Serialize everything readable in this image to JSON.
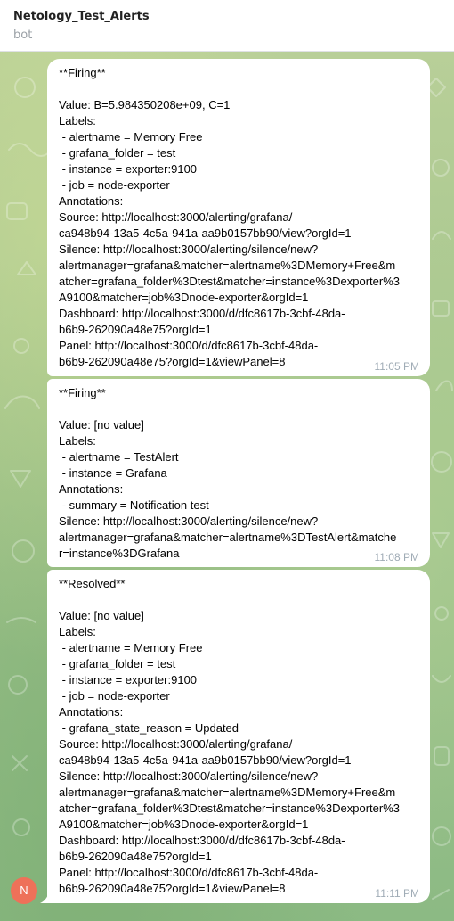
{
  "header": {
    "title": "Netology_Test_Alerts",
    "subtitle": "bot"
  },
  "avatar": {
    "initial": "N",
    "color": "#ee7159"
  },
  "messages": [
    {
      "text": "**Firing**\n\nValue: B=5.984350208e+09, C=1\nLabels:\n - alertname = Memory Free\n - grafana_folder = test\n - instance = exporter:9100\n - job = node-exporter\nAnnotations:\nSource: http://localhost:3000/alerting/grafana/\nca948b94-13a5-4c5a-941a-aa9b0157bb90/view?orgId=1\nSilence: http://localhost:3000/alerting/silence/new?\nalertmanager=grafana&matcher=alertname%3DMemory+Free&m\natcher=grafana_folder%3Dtest&matcher=instance%3Dexporter%3\nA9100&matcher=job%3Dnode-exporter&orgId=1\nDashboard: http://localhost:3000/d/dfc8617b-3cbf-48da-\nb6b9-262090a48e75?orgId=1\nPanel: http://localhost:3000/d/dfc8617b-3cbf-48da-\nb6b9-262090a48e75?orgId=1&viewPanel=8",
      "time": "11:05 PM"
    },
    {
      "text": "**Firing**\n\nValue: [no value]\nLabels:\n - alertname = TestAlert\n - instance = Grafana\nAnnotations:\n - summary = Notification test\nSilence: http://localhost:3000/alerting/silence/new?\nalertmanager=grafana&matcher=alertname%3DTestAlert&matche\nr=instance%3DGrafana",
      "time": "11:08 PM"
    },
    {
      "text": "**Resolved**\n\nValue: [no value]\nLabels:\n - alertname = Memory Free\n - grafana_folder = test\n - instance = exporter:9100\n - job = node-exporter\nAnnotations:\n - grafana_state_reason = Updated\nSource: http://localhost:3000/alerting/grafana/\nca948b94-13a5-4c5a-941a-aa9b0157bb90/view?orgId=1\nSilence: http://localhost:3000/alerting/silence/new?\nalertmanager=grafana&matcher=alertname%3DMemory+Free&m\natcher=grafana_folder%3Dtest&matcher=instance%3Dexporter%3\nA9100&matcher=job%3Dnode-exporter&orgId=1\nDashboard: http://localhost:3000/d/dfc8617b-3cbf-48da-\nb6b9-262090a48e75?orgId=1\nPanel: http://localhost:3000/d/dfc8617b-3cbf-48da-\nb6b9-262090a48e75?orgId=1&viewPanel=8",
      "time": "11:11 PM"
    }
  ]
}
